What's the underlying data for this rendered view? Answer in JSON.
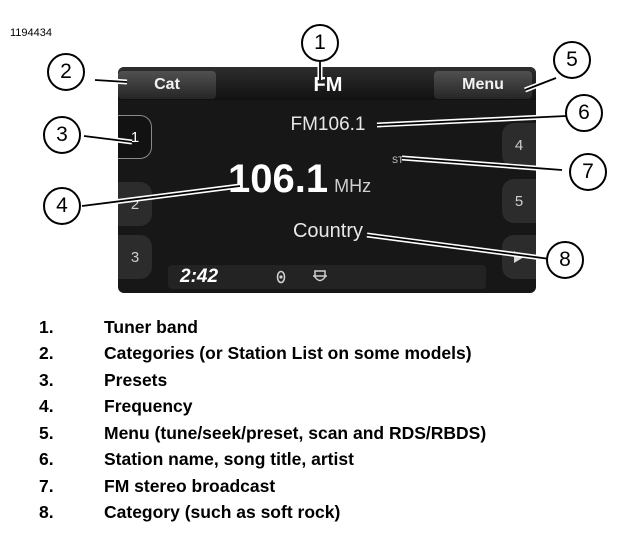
{
  "figure_id": "1194434",
  "radio": {
    "band": "FM",
    "category_button": "Cat",
    "menu_button": "Menu",
    "station_name": "FM106.1",
    "stereo_indicator": "ST",
    "frequency": "106.1",
    "frequency_unit": "MHz",
    "category": "Country",
    "clock": "2:42",
    "presets_left": [
      "1",
      "2",
      "3"
    ],
    "presets_right": [
      "4",
      "5"
    ],
    "active_preset": "1",
    "next_page_icon": "play-icon",
    "status_icons": [
      "satellite-radio-icon",
      "harley-logo-icon"
    ]
  },
  "callouts": [
    "1",
    "2",
    "3",
    "4",
    "5",
    "6",
    "7",
    "8"
  ],
  "legend": [
    {
      "num": "1.",
      "text": "Tuner band"
    },
    {
      "num": "2.",
      "text": "Categories (or Station List on some models)"
    },
    {
      "num": "3.",
      "text": "Presets"
    },
    {
      "num": "4.",
      "text": "Frequency"
    },
    {
      "num": "5.",
      "text": "Menu (tune/seek/preset, scan and RDS/RBDS)"
    },
    {
      "num": "6.",
      "text": "Station name, song title, artist"
    },
    {
      "num": "7.",
      "text": "FM stereo broadcast"
    },
    {
      "num": "8.",
      "text": "Category (such as soft rock)"
    }
  ]
}
